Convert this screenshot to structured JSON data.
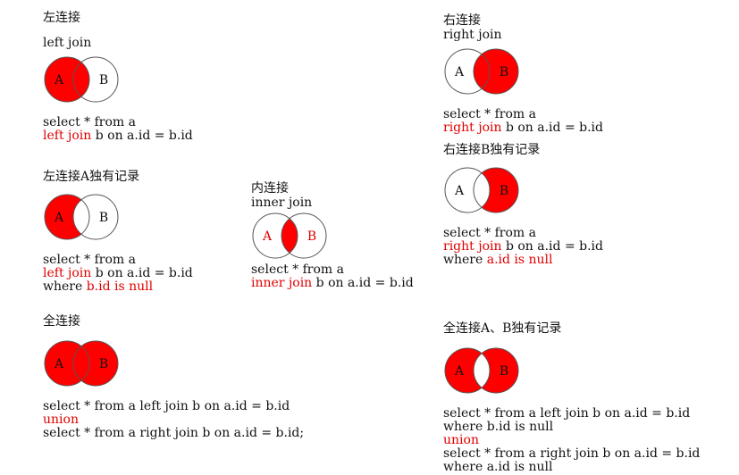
{
  "colors": {
    "fill": "#ff0000",
    "stroke": "#555555",
    "highlight_text": "#e00000",
    "label_on_red": "#111111",
    "label_on_white": "#111111"
  },
  "panels": {
    "left_join": {
      "title": "左连接",
      "subtitle": "left join",
      "circle_a_label": "A",
      "circle_b_label": "B",
      "highlight": "A-all",
      "sql": [
        [
          {
            "t": "select * from a",
            "hl": false
          }
        ],
        [
          {
            "t": "left join",
            "hl": true
          },
          {
            "t": " b on a.id = b.id",
            "hl": false
          }
        ]
      ]
    },
    "right_join": {
      "title": "右连接",
      "subtitle": "right join",
      "circle_a_label": "A",
      "circle_b_label": "B",
      "highlight": "B-all",
      "sql": [
        [
          {
            "t": "select * from a",
            "hl": false
          }
        ],
        [
          {
            "t": "right join",
            "hl": true
          },
          {
            "t": " b on a.id = b.id",
            "hl": false
          }
        ]
      ]
    },
    "left_only": {
      "title": "左连接A独有记录",
      "circle_a_label": "A",
      "circle_b_label": "B",
      "highlight": "A-only",
      "sql": [
        [
          {
            "t": "select * from a",
            "hl": false
          }
        ],
        [
          {
            "t": "left join",
            "hl": true
          },
          {
            "t": " b on a.id = b.id",
            "hl": false
          }
        ],
        [
          {
            "t": "where ",
            "hl": false
          },
          {
            "t": "b.id is null",
            "hl": true
          }
        ]
      ]
    },
    "inner_join": {
      "title": "内连接",
      "subtitle": "inner join",
      "circle_a_label": "A",
      "circle_b_label": "B",
      "highlight": "intersection",
      "sql": [
        [
          {
            "t": "select * from a",
            "hl": false
          }
        ],
        [
          {
            "t": "inner join",
            "hl": true
          },
          {
            "t": " b on a.id = b.id",
            "hl": false
          }
        ]
      ]
    },
    "right_only": {
      "title": "右连接B独有记录",
      "circle_a_label": "A",
      "circle_b_label": "B",
      "highlight": "B-only",
      "sql": [
        [
          {
            "t": "select * from a",
            "hl": false
          }
        ],
        [
          {
            "t": "right join",
            "hl": true
          },
          {
            "t": " b on a.id = b.id",
            "hl": false
          }
        ],
        [
          {
            "t": "where ",
            "hl": false
          },
          {
            "t": "a.id is null",
            "hl": true
          }
        ]
      ]
    },
    "full_join": {
      "title": "全连接",
      "circle_a_label": "A",
      "circle_b_label": "B",
      "highlight": "union",
      "sql": [
        [
          {
            "t": "select * from a left join b on a.id = b.id",
            "hl": false
          }
        ],
        [
          {
            "t": "union",
            "hl": true
          }
        ],
        [
          {
            "t": "select * from a right join b on a.id = b.id;",
            "hl": false
          }
        ]
      ]
    },
    "full_only": {
      "title": "全连接A、B独有记录",
      "circle_a_label": "A",
      "circle_b_label": "B",
      "highlight": "symmetric-difference",
      "sql": [
        [
          {
            "t": "select * from a left join b on a.id = b.id",
            "hl": false
          }
        ],
        [
          {
            "t": "where b.id is null",
            "hl": false
          }
        ],
        [
          {
            "t": "union",
            "hl": true
          }
        ],
        [
          {
            "t": "select * from a right join b on a.id = b.id",
            "hl": false
          }
        ],
        [
          {
            "t": "where a.id is null",
            "hl": false
          }
        ]
      ]
    }
  }
}
